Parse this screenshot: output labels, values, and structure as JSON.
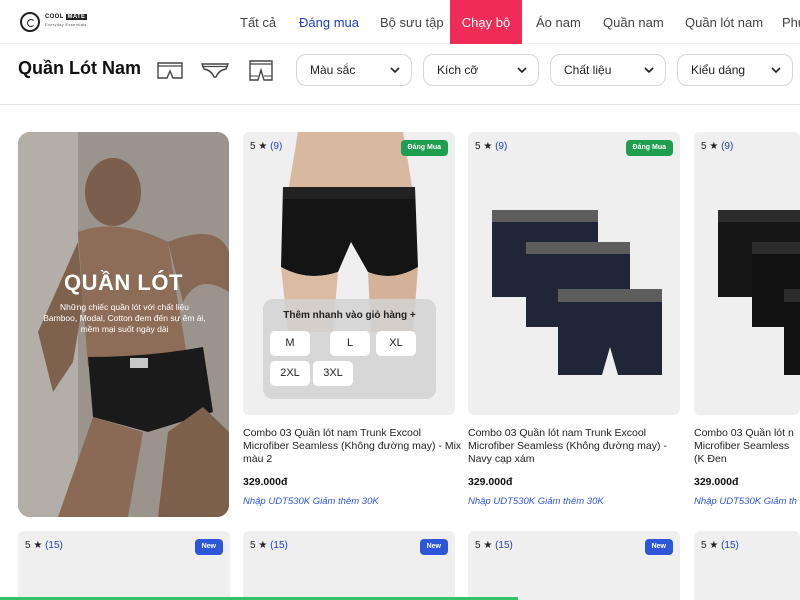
{
  "logo": {
    "brand": "COOL",
    "brand2": "MATE",
    "tagline": "Everyday Essentials"
  },
  "nav": {
    "items": [
      {
        "label": "Tất cả"
      },
      {
        "label": "Đáng mua"
      },
      {
        "label": "Bộ sưu tập"
      },
      {
        "label": "Chạy bộ"
      },
      {
        "label": "Áo nam"
      },
      {
        "label": "Quần nam"
      },
      {
        "label": "Quần lót nam"
      },
      {
        "label": "Phụ"
      }
    ],
    "active": "Chạy bộ"
  },
  "filters": {
    "title": "Quần Lót Nam",
    "underwear_types": [
      "trunk-icon",
      "brief-icon",
      "long-leg-icon"
    ],
    "dropdowns": [
      {
        "label": "Màu sắc"
      },
      {
        "label": "Kích cỡ"
      },
      {
        "label": "Chất liệu"
      },
      {
        "label": "Kiểu dáng"
      }
    ]
  },
  "banner": {
    "title": "QUẦN LÓT",
    "desc": "Những chiếc quần lót với chất liệu Bamboo, Modal, Cotton đem đến sự êm ái, mềm mại suốt ngày dài"
  },
  "products": [
    {
      "rating": "5 ★",
      "count": "(9)",
      "badge": "Đáng Mua",
      "name": "Combo 03 Quần lót nam Trunk Excool Microfiber Seamless (Không đường may) - Mix màu 2",
      "price": "329.000đ",
      "promo": "Nhập UDT530K Giảm thêm 30K"
    },
    {
      "rating": "5 ★",
      "count": "(9)",
      "badge": "Đáng Mua",
      "name": "Combo 03 Quần lót nam Trunk Excool Microfiber Seamless (Không đường may) - Navy cạp xám",
      "price": "329.000đ",
      "promo": "Nhập UDT530K Giảm thêm 30K"
    },
    {
      "rating": "5 ★",
      "count": "(9)",
      "badge": "",
      "name": "Combo 03 Quần lót n Microfiber Seamless (K Đen",
      "price": "329.000đ",
      "promo": "Nhập UDT530K Giảm th"
    }
  ],
  "quick_add": {
    "title": "Thêm nhanh vào giỏ hàng +",
    "sizes": [
      "M",
      "L",
      "XL",
      "2XL",
      "3XL"
    ]
  },
  "row2": [
    {
      "rating": "5 ★",
      "count": "(15)",
      "badge": "New"
    },
    {
      "rating": "5 ★",
      "count": "(15)",
      "badge": "New"
    },
    {
      "rating": "5 ★",
      "count": "(15)",
      "badge": "New"
    },
    {
      "rating": "5 ★",
      "count": "(15)",
      "badge": ""
    }
  ],
  "colors": {
    "accent": "#ee2c55",
    "link": "#1f3fbf",
    "badge_green": "#1e9e4e",
    "badge_blue": "#2e56d9"
  }
}
